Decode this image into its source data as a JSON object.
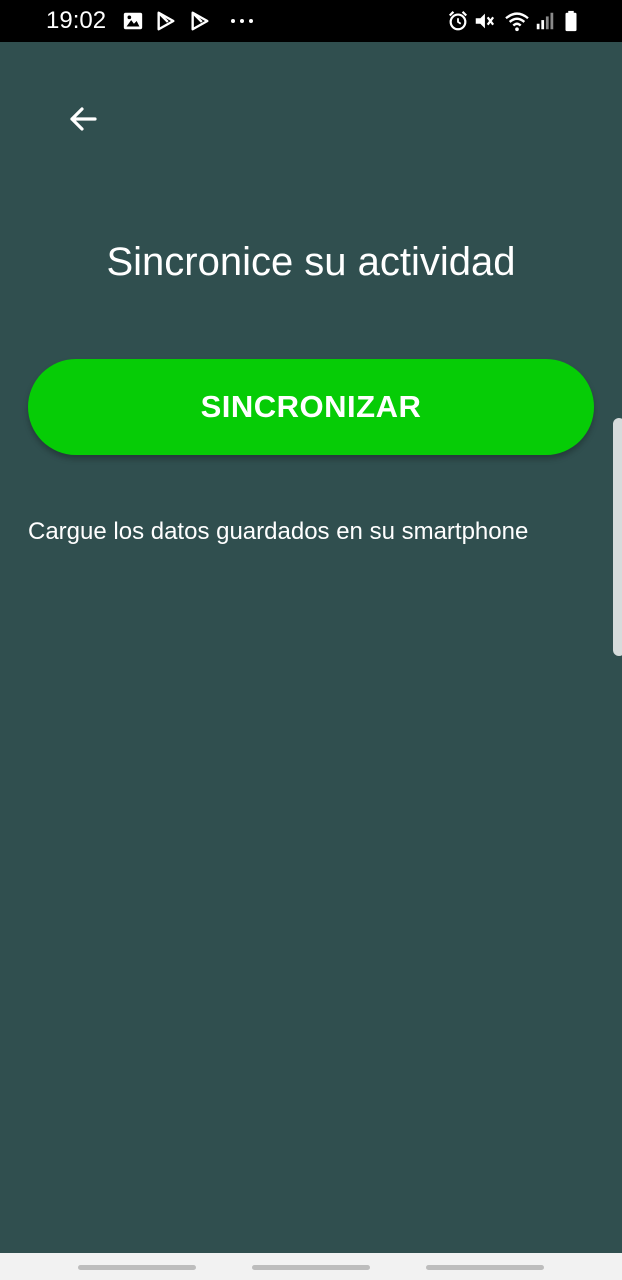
{
  "status_bar": {
    "time": "19:02",
    "left_icons": [
      "image-icon",
      "play-store-icon",
      "play-store-icon",
      "more-notifications-icon"
    ],
    "right_icons": [
      "alarm-icon",
      "vibrate-mute-icon",
      "wifi-icon",
      "signal-icon",
      "battery-icon"
    ],
    "more_glyph": "···"
  },
  "header": {
    "back_icon": "arrow-left-icon"
  },
  "main": {
    "title": "Sincronice su actividad",
    "sync_button_label": "SINCRONIZAR",
    "description": "Cargue los datos guardados en su smartphone"
  },
  "colors": {
    "background": "#304f4f",
    "accent_green": "#06cc06",
    "text": "#ffffff",
    "status_bar": "#000000",
    "nav_bar": "#f2f2f2"
  }
}
